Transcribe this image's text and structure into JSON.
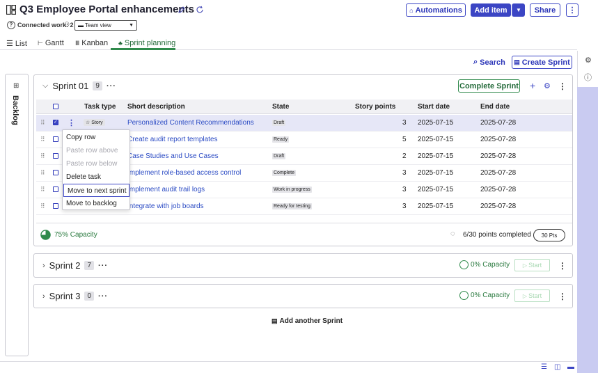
{
  "header": {
    "title": "Q3 Employee Portal enhancements",
    "connected_work": "Connected work: 2",
    "view_select": "Team view",
    "automations_label": "Automations",
    "add_item_label": "Add item",
    "share_label": "Share"
  },
  "tabs": [
    {
      "label": "List"
    },
    {
      "label": "Gantt"
    },
    {
      "label": "Kanban"
    },
    {
      "label": "Sprint planning"
    }
  ],
  "toolbar": {
    "search_label": "Search",
    "create_sprint_label": "Create Sprint"
  },
  "backlog": {
    "label": "Backlog"
  },
  "sprint1": {
    "name": "Sprint 01",
    "count": "9",
    "complete_label": "Complete Sprint",
    "columns": [
      "Task type",
      "Short description",
      "State",
      "Story points",
      "Start date",
      "End date"
    ],
    "rows": [
      {
        "type": "Story",
        "desc": "Personalized Content Recommendations",
        "state": "Draft",
        "points": "3",
        "start": "2025-07-15",
        "end": "2025-07-28",
        "selected": true
      },
      {
        "type": "",
        "desc": "Create audit report templates",
        "state": "Ready",
        "points": "5",
        "start": "2025-07-15",
        "end": "2025-07-28"
      },
      {
        "type": "",
        "desc": "Case Studies and Use Cases",
        "state": "Draft",
        "points": "2",
        "start": "2025-07-15",
        "end": "2025-07-28"
      },
      {
        "type": "",
        "desc": "Implement role-based access control",
        "state": "Complete",
        "points": "3",
        "start": "2025-07-15",
        "end": "2025-07-28"
      },
      {
        "type": "",
        "desc": "Implement audit trail logs",
        "state": "Work in progress",
        "points": "3",
        "start": "2025-07-15",
        "end": "2025-07-28"
      },
      {
        "type": "",
        "desc": "Integrate with job boards",
        "state": "Ready for testing",
        "points": "3",
        "start": "2025-07-15",
        "end": "2025-07-28"
      }
    ],
    "capacity": "75% Capacity",
    "capacity_fraction": 0.75,
    "points_completed": "6/30 points completed",
    "pts": "30 Pts"
  },
  "context_menu": {
    "items": [
      {
        "label": "Copy row",
        "disabled": false
      },
      {
        "label": "Paste row above",
        "disabled": true
      },
      {
        "label": "Paste row below",
        "disabled": true
      },
      {
        "label": "Delete task",
        "disabled": false
      },
      {
        "label": "Move to next sprint",
        "disabled": false,
        "focused": true
      },
      {
        "label": "Move to backlog",
        "disabled": false
      }
    ]
  },
  "sprint2": {
    "name": "Sprint 2",
    "count": "7",
    "capacity": "0% Capacity",
    "start_label": "Start"
  },
  "sprint3": {
    "name": "Sprint 3",
    "count": "0",
    "capacity": "0% Capacity",
    "start_label": "Start"
  },
  "add_sprint_label": "Add another Sprint",
  "colors": {
    "primary": "#3b45c4",
    "green": "#2f8a4b",
    "rail": "#c9cbf1"
  }
}
